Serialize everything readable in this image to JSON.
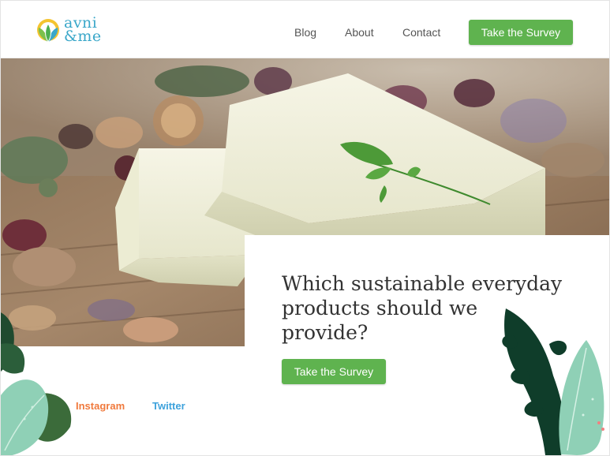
{
  "logo": {
    "line1": "avni",
    "line2": "&me"
  },
  "nav": {
    "blog": "Blog",
    "about": "About",
    "contact": "Contact"
  },
  "header_cta": "Take the Survey",
  "hero": {
    "headline": "Which sustainable everyday products should we provide?",
    "cta": "Take the Survey"
  },
  "social": {
    "instagram": "Instagram",
    "twitter": "Twitter"
  },
  "colors": {
    "accent_green": "#5fb34f",
    "logo_blue": "#3aa7c9",
    "instagram_orange": "#f07a3d",
    "twitter_blue": "#3ea2dc"
  }
}
